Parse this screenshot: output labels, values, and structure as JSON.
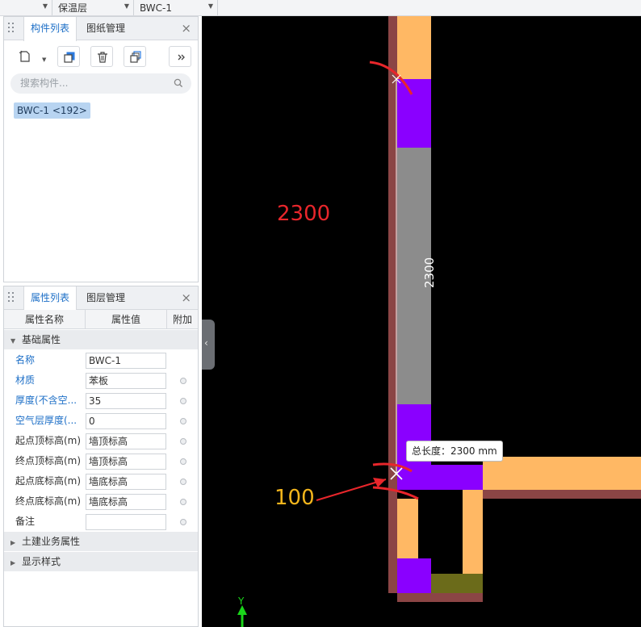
{
  "topbar": {
    "combo_layer": "保温层",
    "combo_component": "BWC-1"
  },
  "component_panel": {
    "tab_active": "构件列表",
    "tab_other": "图纸管理",
    "search_placeholder": "搜索构件...",
    "items": [
      "BWC-1 <192>"
    ]
  },
  "property_panel": {
    "tab_active": "属性列表",
    "tab_other": "图层管理",
    "col_name": "属性名称",
    "col_value": "属性值",
    "col_extra": "附加",
    "group_basic": "基础属性",
    "rows": [
      {
        "name": "名称",
        "value": "BWC-1"
      },
      {
        "name": "材质",
        "value": "苯板"
      },
      {
        "name": "厚度(不含空...",
        "value": "35"
      },
      {
        "name": "空气层厚度(...",
        "value": "0"
      },
      {
        "name": "起点顶标高(m)",
        "value": "墙顶标高"
      },
      {
        "name": "终点顶标高(m)",
        "value": "墙顶标高"
      },
      {
        "name": "起点底标高(m)",
        "value": "墙底标高"
      },
      {
        "name": "终点底标高(m)",
        "value": "墙底标高"
      },
      {
        "name": "备注",
        "value": ""
      }
    ],
    "group_civil": "土建业务属性",
    "group_display": "显示样式"
  },
  "viewport": {
    "tooltip": "总长度：2300 mm",
    "dimension_text": "2300",
    "annotation_length": "2300",
    "annotation_offset": "100",
    "axis_label": "Y",
    "colors": {
      "background": "#000000",
      "insulation": "#ffb864",
      "wall_edge": "#8b4545",
      "selected": "#8a00ff",
      "measured": "#8c8c8c",
      "olive": "#6b6b1a",
      "annotation_red": "#e8262b",
      "annotation_orange": "#f3b51c"
    }
  }
}
